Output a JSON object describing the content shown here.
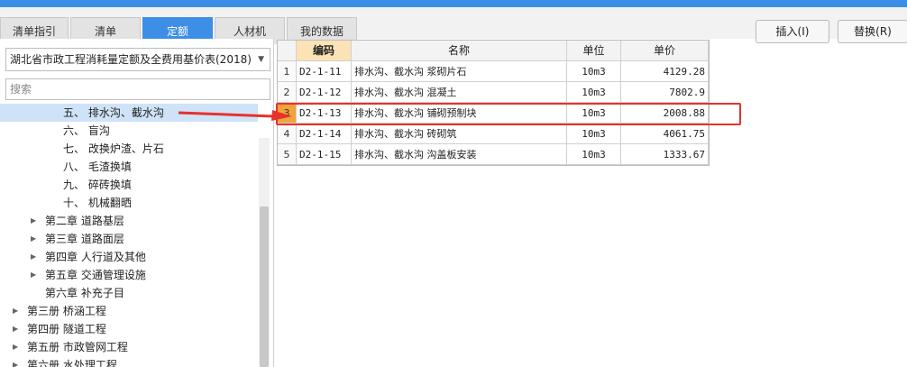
{
  "tabs": [
    "清单指引",
    "清单",
    "定额",
    "人材机",
    "我的数据"
  ],
  "active_tab": "定额",
  "buttons": {
    "insert": "插入(I)",
    "replace": "替换(R)"
  },
  "library_select": "湖北省市政工程消耗量定额及全费用基价表(2018)",
  "search_placeholder": "搜索",
  "tree": [
    {
      "label": "五、 排水沟、截水沟",
      "selected": true,
      "expandable": false
    },
    {
      "label": "六、 盲沟",
      "selected": false,
      "expandable": false
    },
    {
      "label": "七、 改换炉渣、片石",
      "selected": false,
      "expandable": false
    },
    {
      "label": "八、 毛渣换填",
      "selected": false,
      "expandable": false
    },
    {
      "label": "九、 碎砖换填",
      "selected": false,
      "expandable": false
    },
    {
      "label": "十、 机械翻晒",
      "selected": false,
      "expandable": false
    },
    {
      "label": "第二章 道路基层",
      "selected": false,
      "expandable": true
    },
    {
      "label": "第三章 道路面层",
      "selected": false,
      "expandable": true
    },
    {
      "label": "第四章 人行道及其他",
      "selected": false,
      "expandable": true
    },
    {
      "label": "第五章 交通管理设施",
      "selected": false,
      "expandable": true
    },
    {
      "label": "第六章 补充子目",
      "selected": false,
      "expandable": false
    },
    {
      "label": "第三册 桥涵工程",
      "selected": false,
      "expandable": true
    },
    {
      "label": "第四册 隧道工程",
      "selected": false,
      "expandable": true
    },
    {
      "label": "第五册 市政管网工程",
      "selected": false,
      "expandable": true
    },
    {
      "label": "第六册 水处理工程",
      "selected": false,
      "expandable": true
    }
  ],
  "table": {
    "headers": {
      "code": "编码",
      "name": "名称",
      "unit": "单位",
      "price": "单价"
    },
    "rows": [
      {
        "no": "1",
        "code": "D2-1-11",
        "name": "排水沟、截水沟 浆砌片石",
        "unit": "10m3",
        "price": "4129.28"
      },
      {
        "no": "2",
        "code": "D2-1-12",
        "name": "排水沟、截水沟 混凝土",
        "unit": "10m3",
        "price": "7802.9"
      },
      {
        "no": "3",
        "code": "D2-1-13",
        "name": "排水沟、截水沟 铺砌预制块",
        "unit": "10m3",
        "price": "2008.88"
      },
      {
        "no": "4",
        "code": "D2-1-14",
        "name": "排水沟、截水沟 砖砌筑",
        "unit": "10m3",
        "price": "4061.75"
      },
      {
        "no": "5",
        "code": "D2-1-15",
        "name": "排水沟、截水沟 沟盖板安装",
        "unit": "10m3",
        "price": "1333.67"
      }
    ],
    "selected_row": "3"
  },
  "colors": {
    "accent": "#3d8ee6",
    "highlight": "#e8312c",
    "selected_row_marker": "#f2a33a"
  }
}
